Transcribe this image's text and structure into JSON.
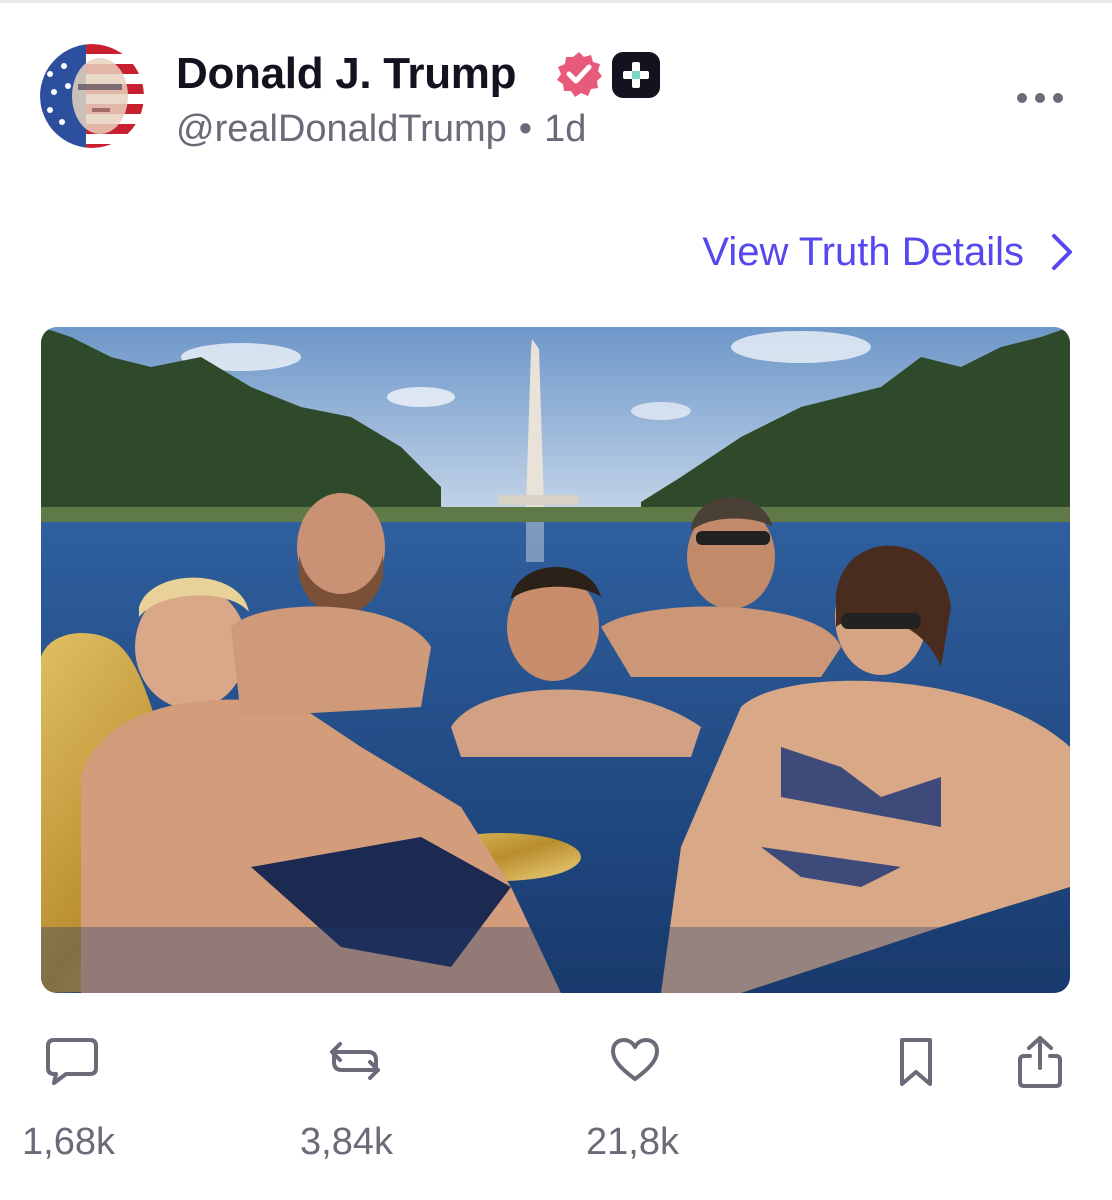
{
  "post": {
    "display_name": "Donald J. Trump",
    "handle": "@realDonaldTrump",
    "separator": "•",
    "age": "1d",
    "view_details_label": "View Truth Details"
  },
  "icons": {
    "avatar": "avatar-flag-portrait",
    "verified": "verified-badge-icon",
    "plus_badge": "plus-badge-icon",
    "more": "more-dots-icon",
    "chevron": "chevron-right-icon",
    "reply": "reply-bubble-icon",
    "retruth": "retruth-icon",
    "like": "heart-icon",
    "bookmark": "bookmark-icon",
    "share": "share-icon"
  },
  "stats": {
    "replies": "1,68k",
    "retruths": "3,84k",
    "likes": "21,8k"
  },
  "colors": {
    "accent": "#5448ee",
    "verified": "#e85a7a",
    "text_primary": "#14121f",
    "text_secondary": "#6b6a78",
    "plus_badge_bg": "#14121f",
    "plus_badge_mark": "#7dd8c8"
  }
}
